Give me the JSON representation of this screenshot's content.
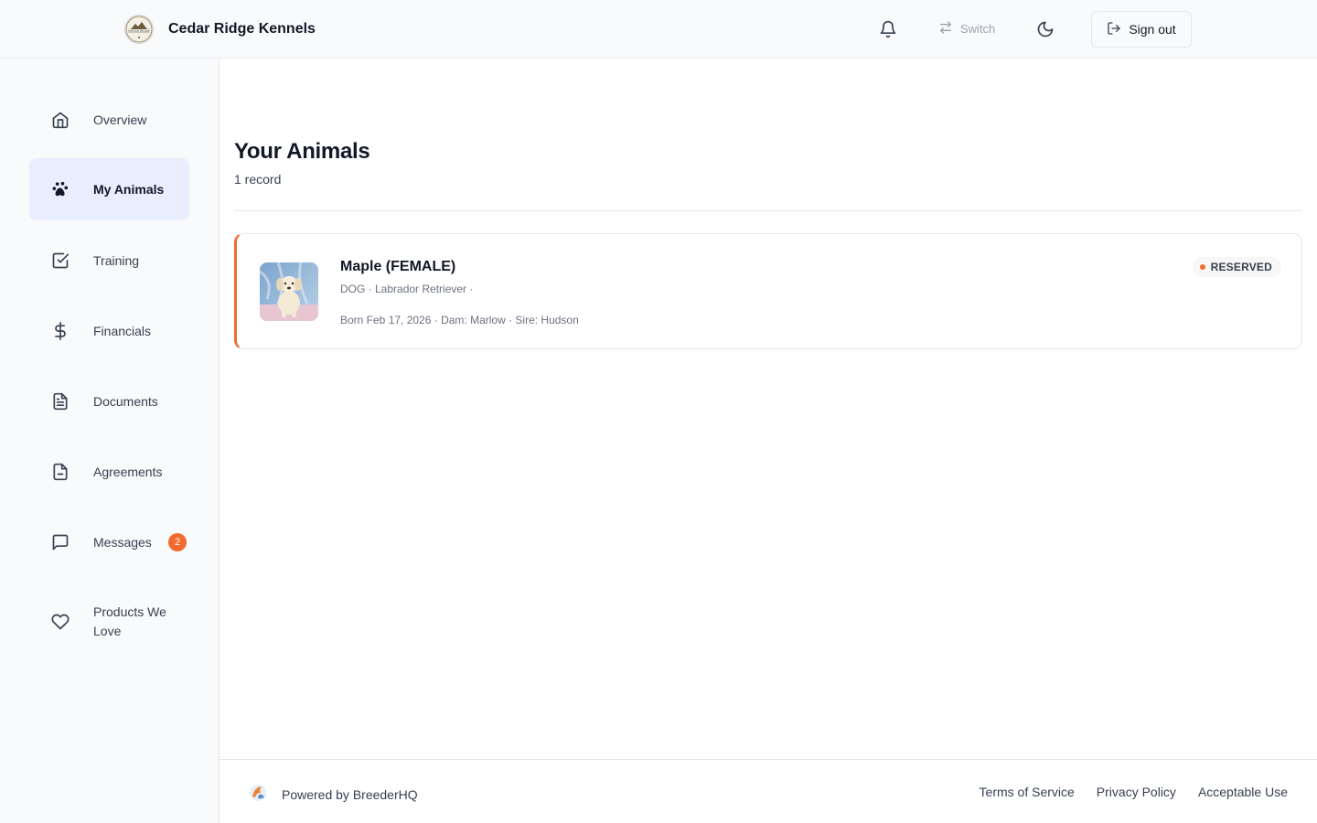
{
  "header": {
    "brand_name": "Cedar Ridge Kennels",
    "logo_text": "CEDAR RIDGE",
    "switch_label": "Switch",
    "signout_label": "Sign out"
  },
  "sidebar": {
    "items": [
      {
        "label": "Overview",
        "icon": "home-icon"
      },
      {
        "label": "My Animals",
        "icon": "paw-icon",
        "active": true
      },
      {
        "label": "Training",
        "icon": "checkbox-icon"
      },
      {
        "label": "Financials",
        "icon": "dollar-icon"
      },
      {
        "label": "Documents",
        "icon": "document-icon"
      },
      {
        "label": "Agreements",
        "icon": "file-icon"
      },
      {
        "label": "Messages",
        "icon": "message-icon",
        "badge": "2"
      },
      {
        "label": "Products We Love",
        "icon": "heart-icon"
      }
    ]
  },
  "main": {
    "title": "Your Animals",
    "record_count": "1 record",
    "animals": [
      {
        "name": "Maple (FEMALE)",
        "meta": "DOG · Labrador Retriever ·",
        "born": "Born Feb 17, 2026 · Dam: Marlow · Sire: Hudson",
        "status": "RESERVED"
      }
    ]
  },
  "footer": {
    "powered_by": "Powered by BreederHQ",
    "links": [
      "Terms of Service",
      "Privacy Policy",
      "Acceptable Use"
    ]
  },
  "colors": {
    "accent": "#f26b2e",
    "active_nav_bg": "#e8eefb",
    "sidebar_bg": "#f9fafb"
  }
}
